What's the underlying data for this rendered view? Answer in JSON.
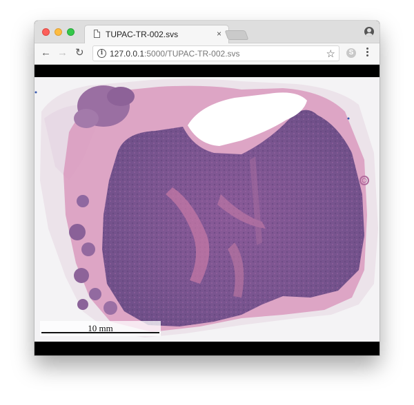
{
  "browser": {
    "tab_title": "TUPAC-TR-002.svs",
    "tab_close": "×",
    "url_host": "127.0.0.1",
    "url_rest": ":5000/TUPAC-TR-002.svs",
    "info_icon": "i",
    "star_icon": "☆",
    "back_icon": "←",
    "forward_icon": "→",
    "reload_icon": "↻",
    "extension_icon": "S"
  },
  "viewer": {
    "scale_label": "10 mm"
  },
  "colors": {
    "tissue_dark": "#7a5590",
    "tissue_pink": "#c46c9a",
    "background": "#f4f3f5",
    "letterbox": "#000000"
  },
  "icons": {
    "profile": "profile-icon",
    "menu": "menu-kebab-icon",
    "document": "document-icon"
  }
}
